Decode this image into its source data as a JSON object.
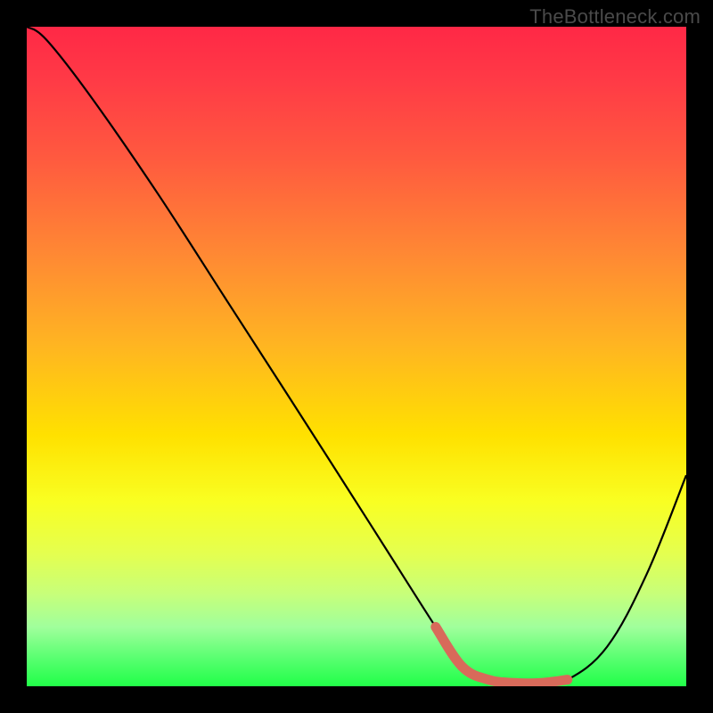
{
  "watermark": "TheBottleneck.com",
  "colors": {
    "background": "#000000",
    "curve": "#000000",
    "highlight": "#d86a5a"
  },
  "chart_data": {
    "type": "line",
    "title": "",
    "xlabel": "",
    "ylabel": "",
    "xlim": [
      0,
      100
    ],
    "ylim": [
      0,
      100
    ],
    "x": [
      0,
      3,
      10,
      20,
      30,
      40,
      48,
      55,
      62,
      66,
      70,
      74,
      78,
      82,
      88,
      94,
      100
    ],
    "values": [
      100,
      98,
      89,
      74.5,
      59,
      43.5,
      31,
      20,
      9,
      3,
      1,
      0.5,
      0.5,
      1,
      6,
      17,
      32
    ],
    "series": [
      {
        "name": "bottleneck-curve",
        "x": [
          0,
          3,
          10,
          20,
          30,
          40,
          48,
          55,
          62,
          66,
          70,
          74,
          78,
          82,
          88,
          94,
          100
        ],
        "values": [
          100,
          98,
          89,
          74.5,
          59,
          43.5,
          31,
          20,
          9,
          3,
          1,
          0.5,
          0.5,
          1,
          6,
          17,
          32
        ]
      },
      {
        "name": "optimal-range-highlight",
        "x": [
          62,
          66,
          70,
          74,
          78,
          82
        ],
        "values": [
          9,
          3,
          1,
          0.5,
          0.5,
          1
        ]
      }
    ],
    "annotations": []
  }
}
